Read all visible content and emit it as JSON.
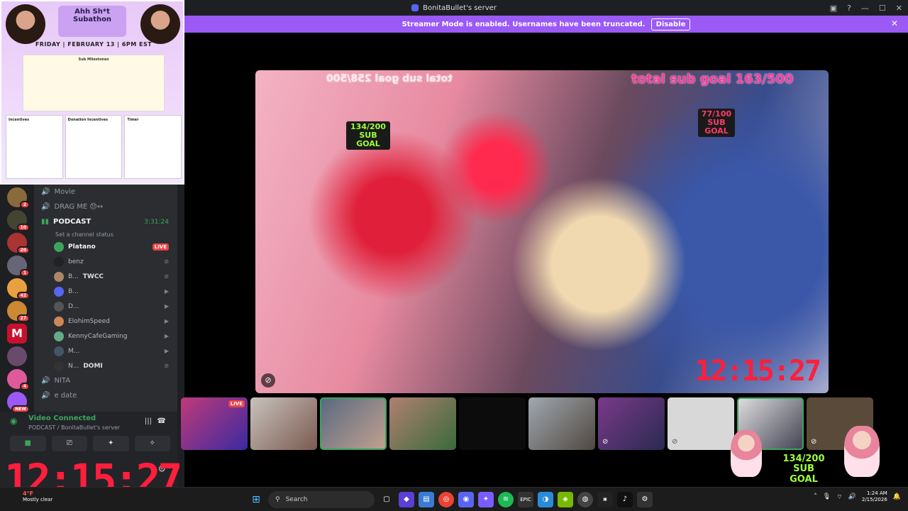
{
  "window": {
    "title": "BonitaBullet's server"
  },
  "banner": {
    "text": "Streamer Mode is enabled. Usernames have been truncated.",
    "disable_label": "Disable"
  },
  "poster": {
    "title": "Ahh Sh*t Subathon",
    "date": "FRIDAY | FEBRUARY 13 | 6PM EST",
    "milestones_title": "Sub Milestones",
    "incentives_title": "Incentives",
    "donation_title": "Donation Incentives",
    "timer_title": "Timer"
  },
  "stream": {
    "total_goal_left": "total sub goal 258/500",
    "total_goal_right": "total sub goal 163/500",
    "sub_goal_1": "134/200 SUB GOAL",
    "sub_goal_2": "77/100 SUB GOAL",
    "timer": "12:15:27"
  },
  "channels": {
    "movie": "Movie",
    "drag_me": "DRAG ME 😞↔",
    "podcast": "PODCAST",
    "podcast_timer": "3:31:24",
    "channel_status": "Set a channel status",
    "nita": "NITA",
    "e_date": "e date"
  },
  "voice_users": [
    {
      "name": "Platano",
      "tag": "LIVE"
    },
    {
      "name": "benz",
      "tag": ""
    },
    {
      "name": "B...",
      "tag": "TWCC"
    },
    {
      "name": "B...",
      "tag": ""
    },
    {
      "name": "D...",
      "tag": ""
    },
    {
      "name": "ElohimSpeed",
      "tag": ""
    },
    {
      "name": "KennyCafeGaming",
      "tag": ""
    },
    {
      "name": "M...",
      "tag": ""
    },
    {
      "name": "N...",
      "tag": "DOMI"
    }
  ],
  "server_badges": [
    "2",
    "10",
    "20",
    "1",
    "42",
    "27",
    "4",
    "NEW"
  ],
  "voice_panel": {
    "status": "Video Connected",
    "sub": "PODCAST / BonitaBullet's server"
  },
  "big_timer": "12:15:27",
  "bottom_goal": "134/200 SUB GOAL",
  "taskbar": {
    "weather_temp": "4°F",
    "weather_text": "Mostly clear",
    "search": "Search",
    "time": "1:24 AM",
    "date": "2/15/2026"
  },
  "thumbs": [
    {
      "live": "LIVE"
    },
    {},
    {},
    {},
    {},
    {},
    {},
    {},
    {},
    {}
  ]
}
